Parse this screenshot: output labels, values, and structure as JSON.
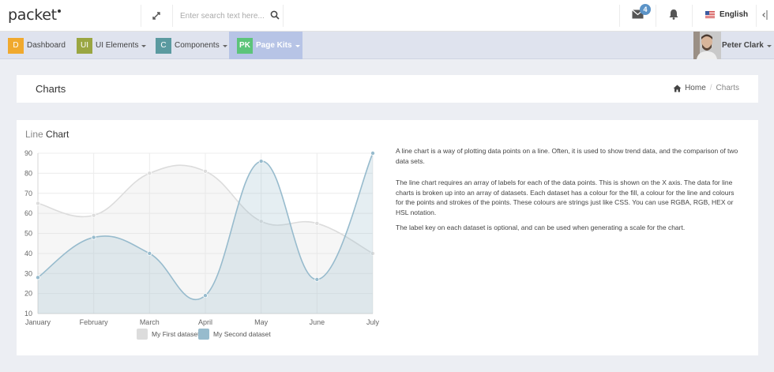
{
  "header": {
    "logo": "packet",
    "search_placeholder": "Enter search text here...",
    "mail_count": "4",
    "language": "English"
  },
  "nav": {
    "items": [
      {
        "badge": "D",
        "label": "Dashboard",
        "color": "#f0a92e",
        "caret": false
      },
      {
        "badge": "UI",
        "label": "UI Elements",
        "color": "#9aa642",
        "caret": true
      },
      {
        "badge": "C",
        "label": "Components",
        "color": "#5b9aa0",
        "caret": true
      },
      {
        "badge": "PK",
        "label": "Page Kits",
        "color": "#5cc47a",
        "caret": true,
        "active": true
      }
    ],
    "user": "Peter Clark"
  },
  "page": {
    "title": "Charts",
    "breadcrumb_home": "Home",
    "breadcrumb_sep": "/",
    "breadcrumb_current": "Charts"
  },
  "panel": {
    "title_light": "Line",
    "title_strong": "Chart",
    "paragraphs": [
      "A line chart is a way of plotting data points on a line. Often, it is used to show trend data, and the comparison of two data sets.",
      "The line chart requires an array of labels for each of the data points. This is shown on the X axis. The data for line charts is broken up into an array of datasets. Each dataset has a colour for the fill, a colour for the line and colours for the points and strokes of the points. These colours are strings just like CSS. You can use RGBA, RGB, HEX or HSL notation.",
      "The label key on each dataset is optional, and can be used when generating a scale for the chart."
    ]
  },
  "chart_data": {
    "type": "line",
    "categories": [
      "January",
      "February",
      "March",
      "April",
      "May",
      "June",
      "July"
    ],
    "series": [
      {
        "name": "My First dataset",
        "values": [
          65,
          59,
          80,
          81,
          56,
          55,
          40
        ],
        "color": "#dcdcdc"
      },
      {
        "name": "My Second dataset",
        "values": [
          28,
          48,
          40,
          19,
          86,
          27,
          90
        ],
        "color": "#97bbcd"
      }
    ],
    "ylim": [
      10,
      90
    ],
    "yticks": [
      "10",
      "20",
      "30",
      "40",
      "50",
      "60",
      "70",
      "80",
      "90"
    ],
    "grid": true,
    "legend": "bottom"
  }
}
